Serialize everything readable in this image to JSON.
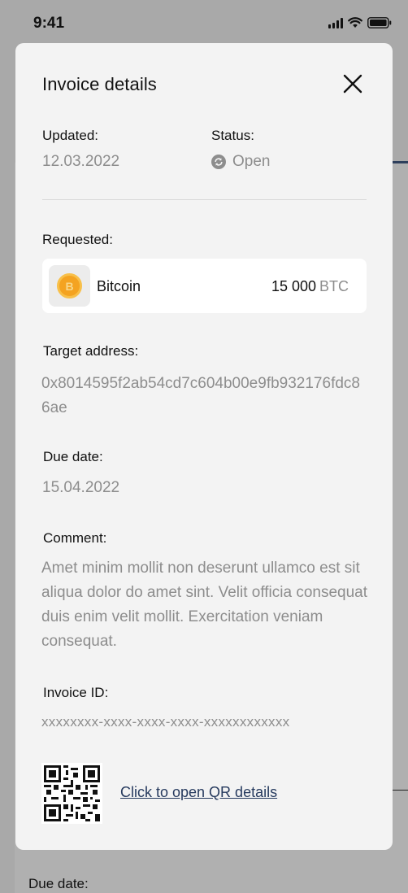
{
  "status_bar": {
    "time": "9:41"
  },
  "background": {
    "due_label": "Due date:"
  },
  "modal": {
    "title": "Invoice details",
    "updated_label": "Updated:",
    "updated_value": "12.03.2022",
    "status_label": "Status:",
    "status_value": "Open",
    "requested_label": "Requested:",
    "token": {
      "name": "Bitcoin",
      "amount": "15 000",
      "unit": "BTC",
      "symbol": "B"
    },
    "target_label": "Target address:",
    "target_value": "0x8014595f2ab54cd7c604b00e9fb932176fdc86ae",
    "due_label": "Due date:",
    "due_value": "15.04.2022",
    "comment_label": "Comment:",
    "comment_value": "Amet minim mollit non deserunt ullamco est sit aliqua dolor do amet sint. Velit officia consequat duis enim velit mollit. Exercitation veniam consequat.",
    "invoice_id_label": "Invoice ID:",
    "invoice_id_value": "xxxxxxxx-xxxx-xxxx-xxxx-xxxxxxxxxxxx",
    "qr_link": "Click to open QR details"
  },
  "colors": {
    "link": "#263a5e",
    "muted_text": "#8d8d8d",
    "coin": "#f4a321",
    "modal_bg": "#f3f3f3",
    "overlay": "#a9a9a9"
  }
}
